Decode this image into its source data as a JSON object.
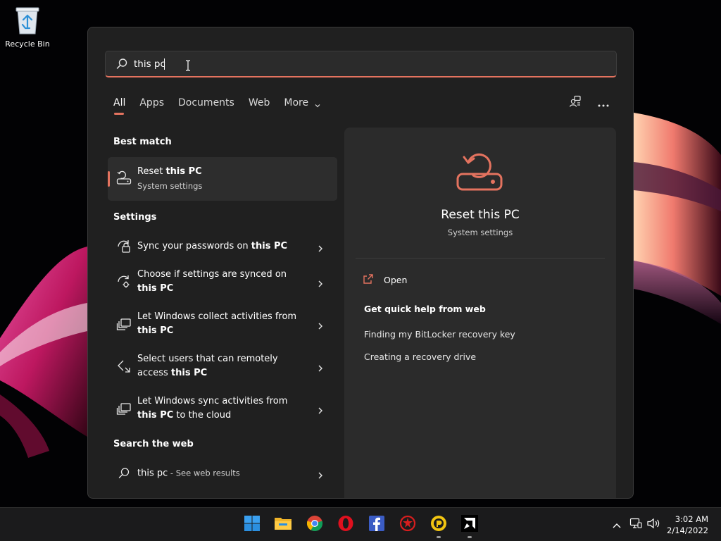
{
  "desktop": {
    "icons": [
      {
        "label": "Recycle Bin",
        "icon": "recycle-bin-icon"
      }
    ]
  },
  "search": {
    "value": "this pc",
    "placeholder": ""
  },
  "tabs": [
    {
      "label": "All",
      "active": true
    },
    {
      "label": "Apps"
    },
    {
      "label": "Documents"
    },
    {
      "label": "Web"
    },
    {
      "label": "More",
      "has_dropdown": true
    }
  ],
  "top_actions": [
    {
      "icon": "account-switch-icon"
    },
    {
      "icon": "more-options-icon"
    }
  ],
  "best_match": {
    "heading": "Best match",
    "item": {
      "title_prefix": "Reset ",
      "title_bold": "this PC",
      "subtitle": "System settings",
      "icon": "reset-pc-icon"
    }
  },
  "settings": {
    "heading": "Settings",
    "items": [
      {
        "pre": "Sync your passwords on ",
        "bold": "this PC",
        "post": "",
        "icon": "sync-passwords-icon"
      },
      {
        "pre": "Choose if settings are synced on ",
        "bold": "this PC",
        "post": "",
        "icon": "sync-settings-icon"
      },
      {
        "pre": "Let Windows collect activities from ",
        "bold": "this PC",
        "post": "",
        "icon": "activity-history-icon"
      },
      {
        "pre": "Select users that can remotely access ",
        "bold": "this PC",
        "post": "",
        "icon": "remote-desktop-icon"
      },
      {
        "pre": "Let Windows sync activities from ",
        "bold": "this PC",
        "post": " to the cloud",
        "icon": "activity-sync-icon"
      }
    ]
  },
  "web": {
    "heading": "Search the web",
    "query": "this pc",
    "suffix": " - See web results"
  },
  "details": {
    "title": "Reset this PC",
    "subtitle": "System settings",
    "icon": "reset-pc-icon",
    "open_label": "Open",
    "help_heading": "Get quick help from web",
    "help_links": [
      "Finding my BitLocker recovery key",
      "Creating a recovery drive"
    ]
  },
  "taskbar": {
    "apps": [
      {
        "icon": "windows-start-icon"
      },
      {
        "icon": "file-explorer-icon"
      },
      {
        "icon": "chrome-icon"
      },
      {
        "icon": "opera-icon"
      },
      {
        "icon": "facebook-icon"
      },
      {
        "icon": "red-app-icon"
      },
      {
        "icon": "yellow-app-icon"
      },
      {
        "icon": "amd-icon"
      }
    ],
    "tray_icons": [
      "show-hidden-icons-icon",
      "network-icon",
      "volume-icon"
    ],
    "time": "3:02 AM",
    "date": "2/14/2022"
  },
  "colors": {
    "accent": "#e4735f",
    "panel_bg": "#202020",
    "details_bg": "#2b2b2b",
    "taskbar_bg": "#1b1b1c"
  }
}
